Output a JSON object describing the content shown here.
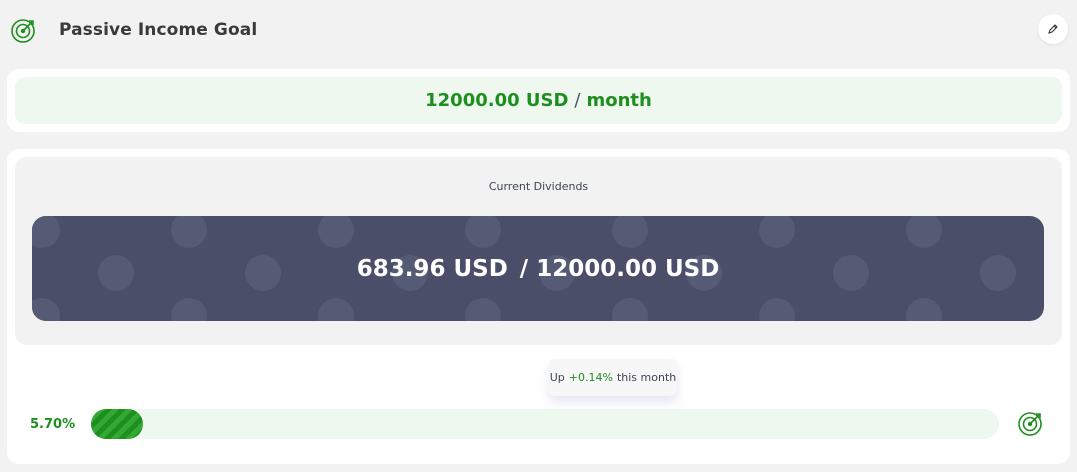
{
  "header": {
    "title": "Passive Income Goal",
    "icon": "target-icon",
    "edit_icon": "pencil-icon"
  },
  "goal": {
    "amount": "12000.00 USD",
    "separator": "/",
    "period": "month"
  },
  "dividends": {
    "label": "Current Dividends",
    "current": "683.96 USD",
    "separator": "/",
    "target": "12000.00 USD"
  },
  "tooltip": {
    "prefix": "Up",
    "change": "+0.14%",
    "suffix": "this month"
  },
  "progress": {
    "label": "5.70%",
    "value": 0.057
  },
  "colors": {
    "accent_green": "#1e8f1e",
    "light_green": "#eef8ee",
    "dark_panel": "#4a4e69",
    "background": "#f2f2f2"
  }
}
